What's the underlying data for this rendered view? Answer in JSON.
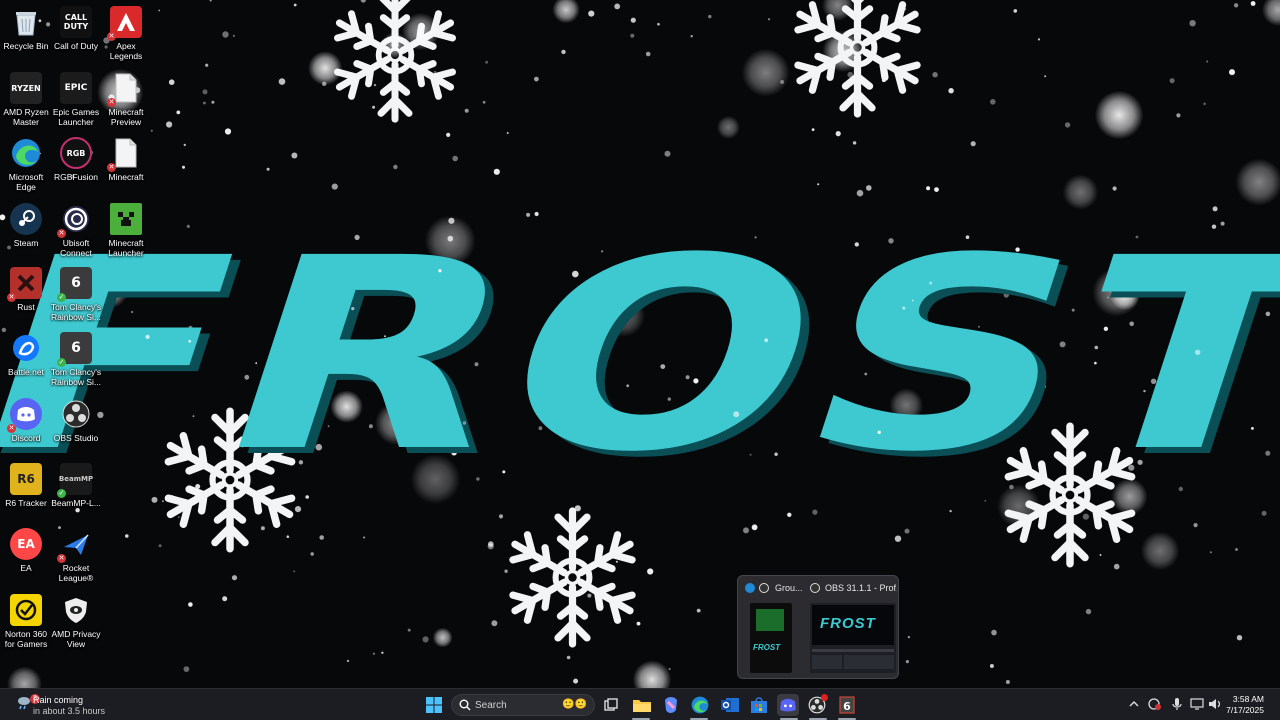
{
  "wallpaper": {
    "title_text": "FROST",
    "colors": {
      "text_fill": "#3ec9d0",
      "text_shadow": "#0c5d66",
      "background": "#07080a",
      "snow": "#ffffff"
    }
  },
  "desktop_icons": [
    {
      "name": "recycle-bin",
      "label": "Recycle Bin",
      "icon": "recycle-bin-icon",
      "badge": "none"
    },
    {
      "name": "call-of-duty",
      "label": "Call of Duty",
      "icon": "call-of-duty-icon",
      "badge": "none"
    },
    {
      "name": "apex-legends",
      "label": "Apex Legends",
      "icon": "apex-legends-icon",
      "badge": "error"
    },
    {
      "name": "amd-ryzen-master",
      "label": "AMD Ryzen Master",
      "icon": "ryzen-icon",
      "badge": "none"
    },
    {
      "name": "epic-games-launcher",
      "label": "Epic Games Launcher",
      "icon": "epic-games-icon",
      "badge": "none"
    },
    {
      "name": "minecraft-preview",
      "label": "Minecraft Preview",
      "icon": "file-icon",
      "badge": "error"
    },
    {
      "name": "microsoft-edge",
      "label": "Microsoft Edge",
      "icon": "edge-icon",
      "badge": "none"
    },
    {
      "name": "rgb-fusion",
      "label": "RGBFusion",
      "icon": "rgb-fusion-icon",
      "badge": "none"
    },
    {
      "name": "minecraft",
      "label": "Minecraft",
      "icon": "file-icon",
      "badge": "error"
    },
    {
      "name": "steam",
      "label": "Steam",
      "icon": "steam-icon",
      "badge": "none"
    },
    {
      "name": "ubisoft-connect",
      "label": "Ubisoft Connect",
      "icon": "ubisoft-icon",
      "badge": "error"
    },
    {
      "name": "minecraft-launcher",
      "label": "Minecraft Launcher",
      "icon": "creeper-icon",
      "badge": "none"
    },
    {
      "name": "rust",
      "label": "Rust",
      "icon": "rust-icon",
      "badge": "error"
    },
    {
      "name": "rainbow-six-1",
      "label": "Tom Clancy's Rainbow Si...",
      "icon": "rainbow-six-icon",
      "badge": "ok"
    },
    {
      "name": "battle-net",
      "label": "Battle.net",
      "icon": "battle-net-icon",
      "badge": "none"
    },
    {
      "name": "rainbow-six-2",
      "label": "Tom Clancy's Rainbow Si...",
      "icon": "rainbow-six-icon",
      "badge": "ok"
    },
    {
      "name": "discord",
      "label": "Discord",
      "icon": "discord-icon",
      "badge": "error"
    },
    {
      "name": "obs-studio",
      "label": "OBS Studio",
      "icon": "obs-icon",
      "badge": "none"
    },
    {
      "name": "r6-tracker",
      "label": "R6 Tracker",
      "icon": "r6-tracker-icon",
      "badge": "none"
    },
    {
      "name": "beammp",
      "label": "BeamMP-L...",
      "icon": "beammp-icon",
      "badge": "ok"
    },
    {
      "name": "ea",
      "label": "EA",
      "icon": "ea-icon",
      "badge": "none"
    },
    {
      "name": "rocket-league",
      "label": "Rocket League®",
      "icon": "rocket-league-icon",
      "badge": "error"
    },
    {
      "name": "norton-360",
      "label": "Norton 360 for Gamers",
      "icon": "norton-icon",
      "badge": "none"
    },
    {
      "name": "amd-privacy-view",
      "label": "AMD Privacy View",
      "icon": "amd-privacy-icon",
      "badge": "none"
    }
  ],
  "taskbar": {
    "weather": {
      "title": "Rain coming",
      "subtitle": "in about 3.5 hours",
      "badge_count": "3"
    },
    "search": {
      "placeholder": "Search"
    },
    "apps": [
      "start",
      "search",
      "task-view",
      "file-explorer",
      "copilot",
      "edge",
      "outlook",
      "microsoft-store",
      "discord",
      "obs-studio",
      "rainbow-six"
    ],
    "clock": {
      "time": "3:58 AM",
      "date": "7/17/2025"
    }
  },
  "preview": {
    "items": [
      {
        "title": "Grou...",
        "thumb_text": "FROST"
      },
      {
        "title": "OBS 31.1.1 - Prof...",
        "thumb_text": "FROST"
      }
    ]
  }
}
